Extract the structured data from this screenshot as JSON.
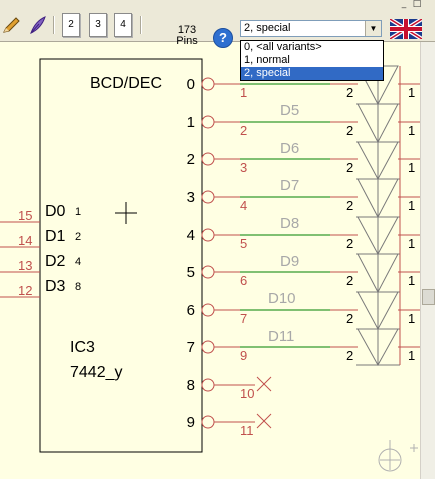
{
  "window_controls": [
    "_",
    "□"
  ],
  "toolbar": {
    "pages": [
      "2",
      "3",
      "4"
    ],
    "pins_count": "173",
    "pins_label": "Pins",
    "help_label": "?"
  },
  "variant_select": {
    "value": "2, special",
    "options": [
      "0, <all variants>",
      "1, normal",
      "2, special"
    ],
    "selected_index": 2
  },
  "colors": {
    "background": "#ffffe3",
    "component_outline": "#000000",
    "pin_number": "#c0504d",
    "net_wire": "#008000",
    "ghost_label": "#a8a8a8",
    "selection": "#316ac5"
  },
  "schematic": {
    "ic": {
      "title": "BCD/DEC",
      "refdes": "IC3",
      "value": "7442_y",
      "outputs": [
        {
          "label": "0",
          "pin": "1"
        },
        {
          "label": "1",
          "pin": "2"
        },
        {
          "label": "2",
          "pin": "3"
        },
        {
          "label": "3",
          "pin": "4"
        },
        {
          "label": "4",
          "pin": "5"
        },
        {
          "label": "5",
          "pin": "6"
        },
        {
          "label": "6",
          "pin": "7"
        },
        {
          "label": "7",
          "pin": "9"
        },
        {
          "label": "8",
          "pin": "10"
        },
        {
          "label": "9",
          "pin": "11"
        }
      ],
      "inputs": [
        {
          "label": "D0",
          "weight": "1",
          "pin": "15"
        },
        {
          "label": "D1",
          "weight": "2",
          "pin": "14"
        },
        {
          "label": "D2",
          "weight": "4",
          "pin": "13"
        },
        {
          "label": "D3",
          "weight": "8",
          "pin": "12"
        }
      ]
    },
    "diode_labels": [
      "D5",
      "D6",
      "D7",
      "D8",
      "D9",
      "D10",
      "D11"
    ],
    "diode_pins": {
      "anode": "2",
      "cathode": "1"
    }
  }
}
